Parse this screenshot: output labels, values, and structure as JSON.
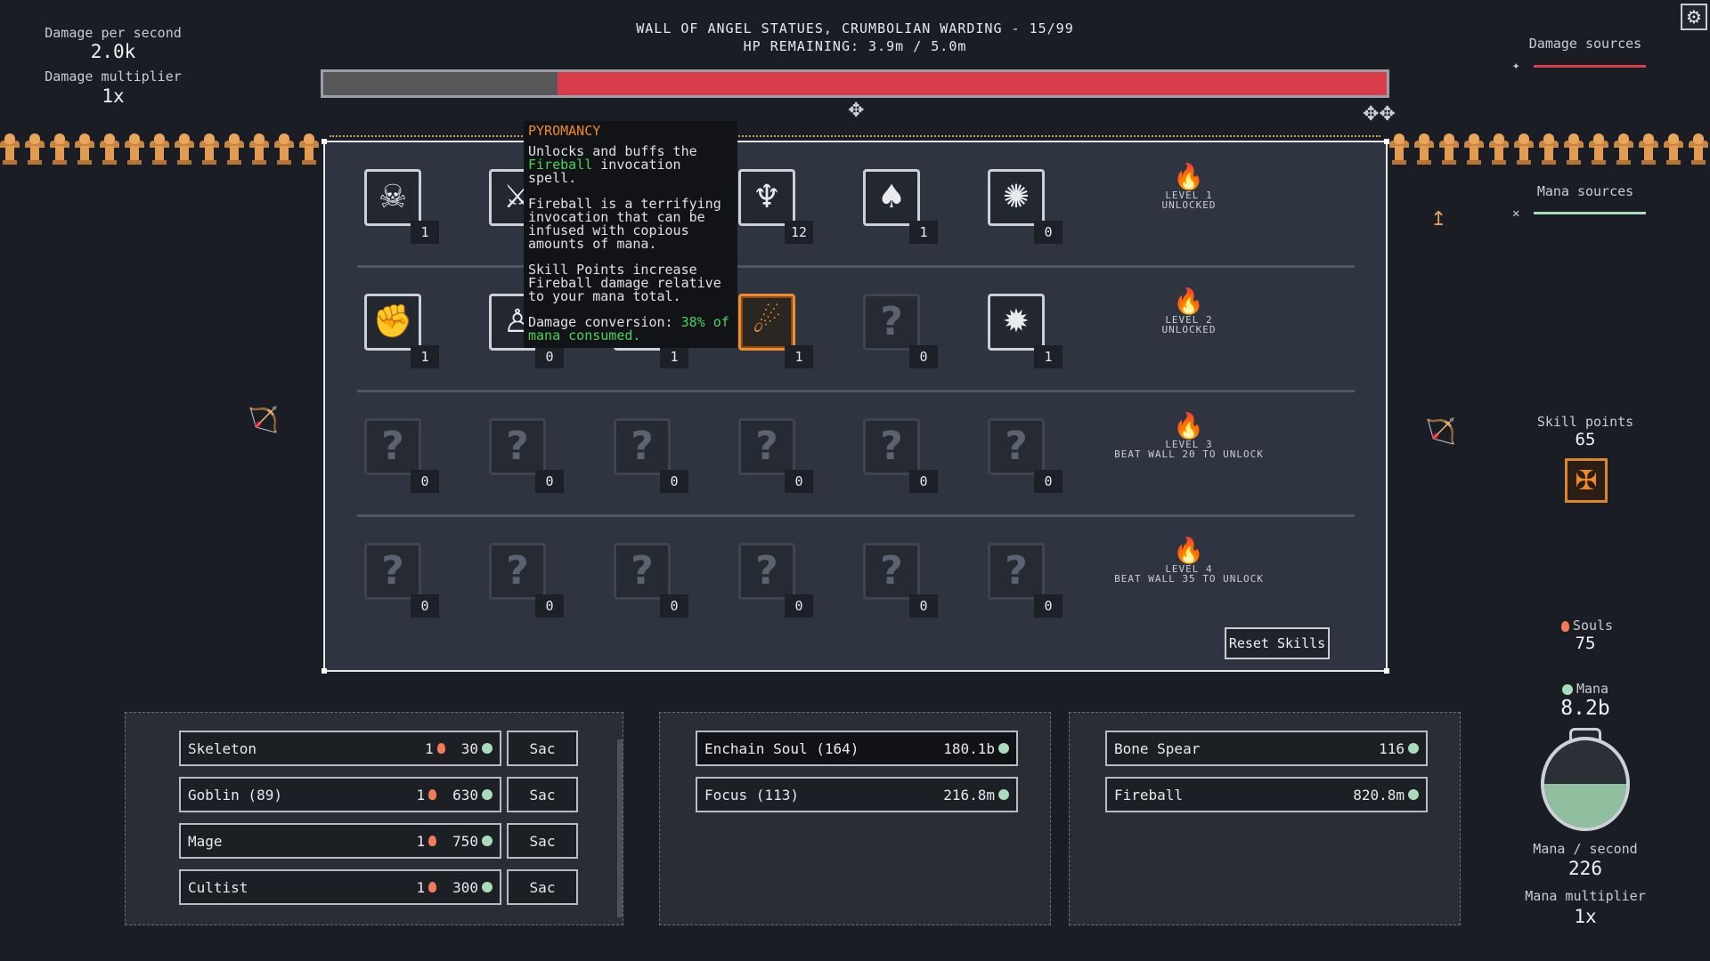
{
  "left_stats": {
    "dps_label": "Damage per second",
    "dps_value": "2.0k",
    "multiplier_label": "Damage multiplier",
    "multiplier_value": "1x"
  },
  "header": {
    "wall_title": "WALL OF ANGEL STATUES, CRUMBOLIAN WARDING - 15/99",
    "hp_text": "HP REMAINING: 3.9m / 5.0m",
    "hp_fraction": 0.78
  },
  "tooltip": {
    "title": "PYROMANCY",
    "line1a": "Unlocks and buffs the",
    "line1b": "Fireball",
    "line1c": "invocation spell.",
    "para2": "Fireball is a terrifying invocation that can be infused with copious amounts of mana.",
    "para3": "Skill Points increase Fireball damage relative to your mana total.",
    "conv_label": "Damage conversion:",
    "conv_value": "38%",
    "conv_tail": "of mana consumed."
  },
  "skill_rows": [
    {
      "skills": [
        {
          "icon": "skull-icon",
          "glyph": "☠",
          "count": "1",
          "locked": false
        },
        {
          "icon": "sword-icon",
          "glyph": "⚔",
          "count": "",
          "locked": false
        },
        {
          "icon": "hidden-icon",
          "glyph": "",
          "count": "",
          "locked": false
        },
        {
          "icon": "angel-icon",
          "glyph": "♆",
          "count": "12",
          "locked": false
        },
        {
          "icon": "drops-icon",
          "glyph": "♠",
          "count": "1",
          "locked": false
        },
        {
          "icon": "sun-icon",
          "glyph": "✺",
          "count": "0",
          "locked": false
        }
      ],
      "level_title": "LEVEL 1",
      "level_status": "UNLOCKED",
      "unlocked": true
    },
    {
      "skills": [
        {
          "icon": "fist-icon",
          "glyph": "✊",
          "count": "1",
          "locked": false
        },
        {
          "icon": "figure-icon",
          "glyph": "♙",
          "count": "0",
          "locked": false
        },
        {
          "icon": "hidden-icon",
          "glyph": "",
          "count": "1",
          "locked": false
        },
        {
          "icon": "fireball-icon",
          "glyph": "☄",
          "count": "1",
          "locked": false,
          "selected": true
        },
        {
          "icon": "locked-skill-icon",
          "glyph": "?",
          "count": "0",
          "locked": true
        },
        {
          "icon": "burst-icon",
          "glyph": "✹",
          "count": "1",
          "locked": false
        }
      ],
      "level_title": "LEVEL 2",
      "level_status": "UNLOCKED",
      "unlocked": true
    },
    {
      "skills": [
        {
          "icon": "locked-skill-icon",
          "glyph": "?",
          "count": "0",
          "locked": true
        },
        {
          "icon": "locked-skill-icon",
          "glyph": "?",
          "count": "0",
          "locked": true
        },
        {
          "icon": "locked-skill-icon",
          "glyph": "?",
          "count": "0",
          "locked": true
        },
        {
          "icon": "locked-skill-icon",
          "glyph": "?",
          "count": "0",
          "locked": true
        },
        {
          "icon": "locked-skill-icon",
          "glyph": "?",
          "count": "0",
          "locked": true
        },
        {
          "icon": "locked-skill-icon",
          "glyph": "?",
          "count": "0",
          "locked": true
        }
      ],
      "level_title": "LEVEL 3",
      "level_status": "BEAT WALL 20 TO UNLOCK",
      "unlocked": false
    },
    {
      "skills": [
        {
          "icon": "locked-skill-icon",
          "glyph": "?",
          "count": "0",
          "locked": true
        },
        {
          "icon": "locked-skill-icon",
          "glyph": "?",
          "count": "0",
          "locked": true
        },
        {
          "icon": "locked-skill-icon",
          "glyph": "?",
          "count": "0",
          "locked": true
        },
        {
          "icon": "locked-skill-icon",
          "glyph": "?",
          "count": "0",
          "locked": true
        },
        {
          "icon": "locked-skill-icon",
          "glyph": "?",
          "count": "0",
          "locked": true
        },
        {
          "icon": "locked-skill-icon",
          "glyph": "?",
          "count": "0",
          "locked": true
        }
      ],
      "level_title": "LEVEL 4",
      "level_status": "BEAT WALL 35 TO UNLOCK",
      "unlocked": false
    }
  ],
  "reset_label": "Reset Skills",
  "right": {
    "damage_sources_label": "Damage sources",
    "mana_sources_label": "Mana sources",
    "skill_points_label": "Skill points",
    "skill_points_value": "65",
    "souls_label": "Souls",
    "souls_value": "75",
    "mana_label": "Mana",
    "mana_value": "8.2b",
    "mana_fill_fraction": 0.5,
    "mana_per_sec_label": "Mana / second",
    "mana_per_sec_value": "226",
    "mana_mult_label": "Mana multiplier",
    "mana_mult_value": "1x"
  },
  "minions": [
    {
      "name": "Skeleton",
      "souls": "1",
      "mana": "30",
      "sac": "Sac"
    },
    {
      "name": "Goblin (89)",
      "souls": "1",
      "mana": "630",
      "sac": "Sac"
    },
    {
      "name": "Mage",
      "souls": "1",
      "mana": "750",
      "sac": "Sac"
    },
    {
      "name": "Cultist",
      "souls": "1",
      "mana": "300",
      "sac": "Sac"
    }
  ],
  "rituals": [
    {
      "name": "Enchain Soul (164)",
      "cost": "180.1b"
    },
    {
      "name": "Focus (113)",
      "cost": "216.8m"
    }
  ],
  "spells": [
    {
      "name": "Bone Spear",
      "cost": "116"
    },
    {
      "name": "Fireball",
      "cost": "820.8m"
    }
  ],
  "colors": {
    "hp": "#da3d4a",
    "accent": "#f08a2c",
    "mana": "#a9dcb8",
    "highlight_green": "#49d35b"
  }
}
